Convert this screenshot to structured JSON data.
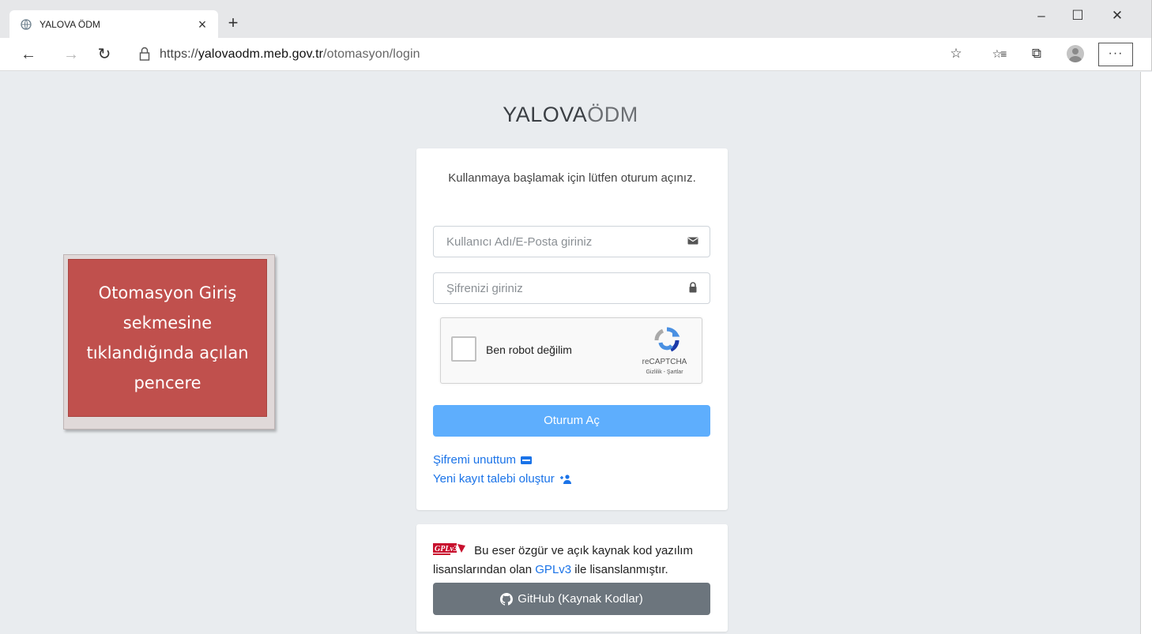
{
  "browser": {
    "tab_title": "YALOVA ÖDM",
    "tab_close": "×",
    "new_tab": "+",
    "window_controls": {
      "minimize": "–",
      "maximize": "☐",
      "close": "✕"
    },
    "nav": {
      "back": "←",
      "forward": "→",
      "refresh": "↻"
    },
    "url": {
      "scheme": "https://",
      "host": "yalovaodm.meb.gov.tr",
      "path": "/otomasyon/login"
    },
    "toolbar": {
      "favorite": "☆",
      "favorites_list": "☆≡",
      "collections": "⧉",
      "more": "···"
    }
  },
  "brand": {
    "bold": "YALOVA",
    "light": "ÖDM"
  },
  "login": {
    "message": "Kullanmaya başlamak için lütfen oturum açınız.",
    "username_placeholder": "Kullanıcı Adı/E-Posta giriniz",
    "password_placeholder": "Şifrenizi giriniz",
    "captcha": {
      "label": "Ben robot değilim",
      "brand": "reCAPTCHA",
      "terms": "Gizlilik - Şartlar"
    },
    "submit_label": "Oturum Aç",
    "forgot_label": "Şifremi unuttum",
    "register_label": "Yeni kayıt talebi oluştur"
  },
  "license": {
    "text_before": "Bu eser özgür ve açık kaynak kod yazılım lisanslarından olan",
    "link": "GPLv3",
    "text_after": "ile lisanslanmıştır.",
    "github_label": "GitHub (Kaynak Kodlar)"
  },
  "annotation": {
    "text": "Otomasyon Giriş sekmesine tıklandığında açılan pencere"
  },
  "colors": {
    "primary_button": "#5eaefd",
    "link": "#1a73e8",
    "github_button": "#6c757d",
    "callout": "#c0504d",
    "page_bg": "#e9ecef"
  },
  "icons": [
    "globe-favicon",
    "lock-icon",
    "envelope-icon",
    "padlock-icon",
    "recaptcha-logo",
    "id-card-icon",
    "user-plus-icon",
    "gpl-logo",
    "github-icon"
  ]
}
